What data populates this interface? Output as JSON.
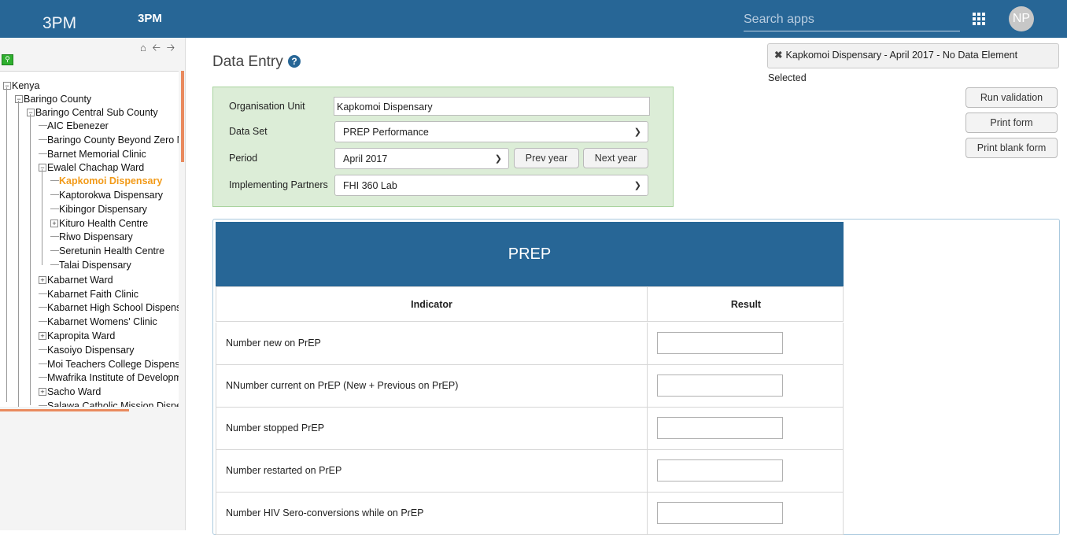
{
  "header": {
    "logo": "3PM",
    "app_title": "3PM",
    "search_placeholder": "Search apps",
    "avatar_initials": "NP"
  },
  "tree": {
    "nodes": [
      {
        "label": "Kenya",
        "exp": "−"
      },
      {
        "label": "Baringo County",
        "exp": "−"
      },
      {
        "label": "Baringo Central Sub County",
        "exp": "−"
      },
      {
        "label": "AIC Ebenezer",
        "exp": ""
      },
      {
        "label": "Baringo County Beyond Zero M",
        "exp": ""
      },
      {
        "label": "Barnet Memorial Clinic",
        "exp": ""
      },
      {
        "label": "Ewalel Chachap Ward",
        "exp": "−"
      },
      {
        "label": "Kapkomoi Dispensary",
        "exp": ""
      },
      {
        "label": "Kaptorokwa Dispensary",
        "exp": ""
      },
      {
        "label": "Kibingor Dispensary",
        "exp": ""
      },
      {
        "label": "Kituro Health Centre",
        "exp": "+"
      },
      {
        "label": "Riwo Dispensary",
        "exp": ""
      },
      {
        "label": "Seretunin Health Centre",
        "exp": ""
      },
      {
        "label": "Talai Dispensary",
        "exp": ""
      },
      {
        "label": "Kabarnet Ward",
        "exp": "+"
      },
      {
        "label": "Kabarnet Faith Clinic",
        "exp": ""
      },
      {
        "label": "Kabarnet High School Dispens",
        "exp": ""
      },
      {
        "label": "Kabarnet Womens' Clinic",
        "exp": ""
      },
      {
        "label": "Kapropita Ward",
        "exp": "+"
      },
      {
        "label": "Kasoiyo Dispensary",
        "exp": ""
      },
      {
        "label": "Moi Teachers College Dispens",
        "exp": ""
      },
      {
        "label": "Mwafrika Institute of Developm",
        "exp": ""
      },
      {
        "label": "Sacho Ward",
        "exp": "+"
      },
      {
        "label": "Salawa Catholic Mission Dispe",
        "exp": ""
      }
    ]
  },
  "main": {
    "title": "Data Entry",
    "help_icon": "?",
    "notice_icon": "✖",
    "notice": "Kapkomoi Dispensary - April 2017 - No Data Element Selected",
    "selection": {
      "org_unit_label": "Organisation Unit",
      "org_unit_value": "Kapkomoi Dispensary",
      "data_set_label": "Data Set",
      "data_set_value": "PREP Performance",
      "period_label": "Period",
      "period_value": "April 2017",
      "prev_year": "Prev year",
      "next_year": "Next year",
      "partners_label": "Implementing Partners",
      "partners_value": "FHI 360 Lab"
    },
    "buttons": {
      "run_validation": "Run validation",
      "print_form": "Print form",
      "print_blank_form": "Print blank form"
    },
    "form": {
      "title": "PREP",
      "col_indicator": "Indicator",
      "col_result": "Result",
      "rows": [
        {
          "indicator": "Number new on PrEP",
          "value": ""
        },
        {
          "indicator": "NNumber current on PrEP (New + Previous on PrEP)",
          "value": ""
        },
        {
          "indicator": "Number stopped PrEP",
          "value": ""
        },
        {
          "indicator": "Number restarted on PrEP",
          "value": ""
        },
        {
          "indicator": "Number HIV Sero-conversions while on PrEP",
          "value": ""
        }
      ]
    }
  },
  "colors": {
    "header": "#276696",
    "selected_node": "#f29a18",
    "selection_bg": "#dcedd7"
  }
}
